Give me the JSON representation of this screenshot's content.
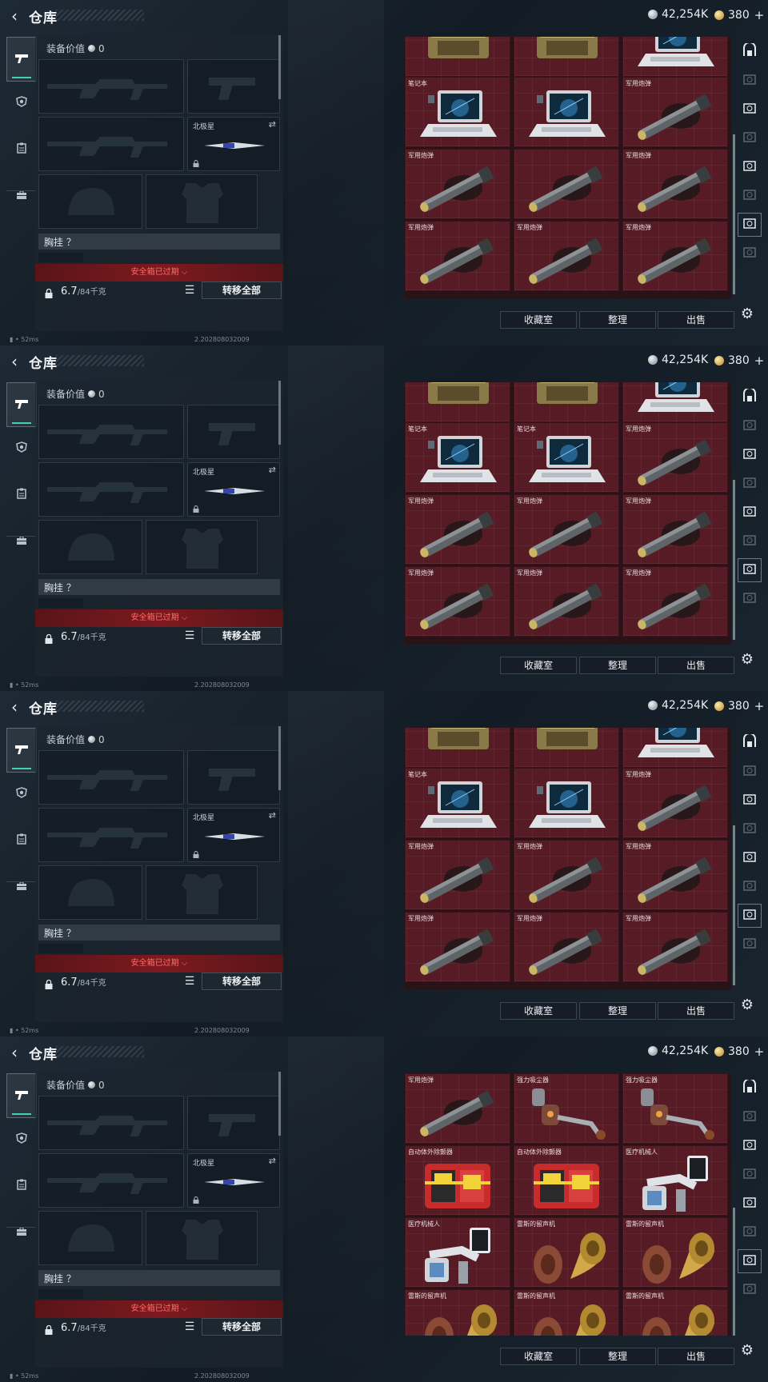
{
  "title": "仓库",
  "currency": {
    "silver": "42,254K",
    "gold": "380",
    "gold_plus": "+"
  },
  "equip": {
    "value_label": "装备价值",
    "value": "0",
    "knife_name": "北极星",
    "vest_label": "胸挂 ？",
    "safe_box": "安全箱已过期",
    "weight": "6.7",
    "weight_max": "/84千克",
    "transfer_all": "转移全部"
  },
  "status": {
    "ping": "52ms",
    "build": "2.202808032009"
  },
  "buttons": {
    "collection": "收藏室",
    "sort": "整理",
    "sell": "出售"
  },
  "item_names": {
    "laptop": "笔记本",
    "missile": "军用炮弹",
    "vacuum": "强力吸尘器",
    "defib": "自动体外除颤器",
    "robot": "医疗机械人",
    "phono": "雷斯的留声机"
  },
  "frames": [
    {
      "rows": [
        {
          "type": "partial",
          "items": [
            {
              "icon": "case-icon",
              "label": ""
            },
            {
              "icon": "case-icon",
              "label": ""
            },
            {
              "icon": "laptop-icon",
              "label": ""
            }
          ]
        },
        {
          "items": [
            {
              "icon": "laptop-icon",
              "label": "笔记本"
            },
            {
              "icon": "laptop-icon",
              "label": ""
            },
            {
              "icon": "missile-icon",
              "label": "军用炮弹"
            }
          ]
        },
        {
          "items": [
            {
              "icon": "missile-icon",
              "label": "军用炮弹"
            },
            {
              "icon": "missile-icon",
              "label": ""
            },
            {
              "icon": "missile-icon",
              "label": "军用炮弹"
            }
          ]
        },
        {
          "items": [
            {
              "icon": "missile-icon",
              "label": "军用炮弹"
            },
            {
              "icon": "missile-icon",
              "label": "军用炮弹"
            },
            {
              "icon": "missile-icon",
              "label": "军用炮弹"
            }
          ]
        }
      ]
    },
    {
      "rows": [
        {
          "type": "partial",
          "items": [
            {
              "icon": "case-icon",
              "label": ""
            },
            {
              "icon": "case-icon",
              "label": ""
            },
            {
              "icon": "laptop-icon",
              "label": ""
            }
          ]
        },
        {
          "items": [
            {
              "icon": "laptop-icon",
              "label": "笔记本"
            },
            {
              "icon": "laptop-icon",
              "label": "笔记本"
            },
            {
              "icon": "missile-icon",
              "label": "军用炮弹"
            }
          ]
        },
        {
          "items": [
            {
              "icon": "missile-icon",
              "label": "军用炮弹"
            },
            {
              "icon": "missile-icon",
              "label": "军用炮弹"
            },
            {
              "icon": "missile-icon",
              "label": "军用炮弹"
            }
          ]
        },
        {
          "items": [
            {
              "icon": "missile-icon",
              "label": "军用炮弹"
            },
            {
              "icon": "missile-icon",
              "label": "军用炮弹"
            },
            {
              "icon": "missile-icon",
              "label": "军用炮弹"
            }
          ]
        }
      ]
    },
    {
      "rows": [
        {
          "type": "partial",
          "items": [
            {
              "icon": "case-icon",
              "label": ""
            },
            {
              "icon": "case-icon",
              "label": ""
            },
            {
              "icon": "laptop-icon",
              "label": ""
            }
          ]
        },
        {
          "items": [
            {
              "icon": "laptop-icon",
              "label": "笔记本"
            },
            {
              "icon": "laptop-icon",
              "label": ""
            },
            {
              "icon": "missile-icon",
              "label": "军用炮弹"
            }
          ]
        },
        {
          "items": [
            {
              "icon": "missile-icon",
              "label": "军用炮弹"
            },
            {
              "icon": "missile-icon",
              "label": "军用炮弹"
            },
            {
              "icon": "missile-icon",
              "label": "军用炮弹"
            }
          ]
        },
        {
          "items": [
            {
              "icon": "missile-icon",
              "label": "军用炮弹"
            },
            {
              "icon": "missile-icon",
              "label": "军用炮弹"
            },
            {
              "icon": "missile-icon",
              "label": "军用炮弹"
            }
          ]
        }
      ]
    },
    {
      "rows": [
        {
          "items": [
            {
              "icon": "missile-icon",
              "label": "军用炮弹"
            },
            {
              "icon": "vacuum-icon",
              "label": "强力吸尘器"
            },
            {
              "icon": "vacuum-icon",
              "label": "强力吸尘器"
            }
          ]
        },
        {
          "items": [
            {
              "icon": "defib-icon",
              "label": "自动体外除颤器"
            },
            {
              "icon": "defib-icon",
              "label": "自动体外除颤器"
            },
            {
              "icon": "robot-icon",
              "label": "医疗机械人"
            }
          ]
        },
        {
          "items": [
            {
              "icon": "robot-icon",
              "label": "医疗机械人"
            },
            {
              "icon": "phonograph-icon",
              "label": "雷斯的留声机"
            },
            {
              "icon": "phonograph-icon",
              "label": "雷斯的留声机"
            }
          ]
        },
        {
          "items": [
            {
              "icon": "phonograph-icon",
              "label": "雷斯的留声机"
            },
            {
              "icon": "phonograph-icon",
              "label": "雷斯的留声机"
            },
            {
              "icon": "phonograph-icon",
              "label": "雷斯的留声机"
            }
          ]
        }
      ]
    }
  ]
}
